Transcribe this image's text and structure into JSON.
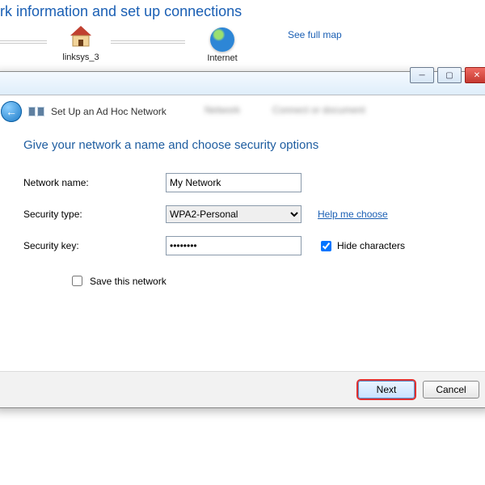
{
  "background": {
    "heading": "rk information and set up connections",
    "nodes": [
      {
        "label": "linksys_3"
      },
      {
        "label": "Internet"
      }
    ],
    "see_map": "See full map"
  },
  "wizard": {
    "title": "Set Up an Ad Hoc Network",
    "heading": "Give your network a name and choose security options",
    "fields": {
      "network_name": {
        "label": "Network name:",
        "value": "My Network"
      },
      "security_type": {
        "label": "Security type:",
        "value": "WPA2-Personal"
      },
      "security_key": {
        "label": "Security key:",
        "value": "••••••••"
      }
    },
    "help_link": "Help me choose",
    "hide_characters": "Hide characters",
    "save_network": "Save this network",
    "buttons": {
      "next": "Next",
      "cancel": "Cancel"
    }
  }
}
